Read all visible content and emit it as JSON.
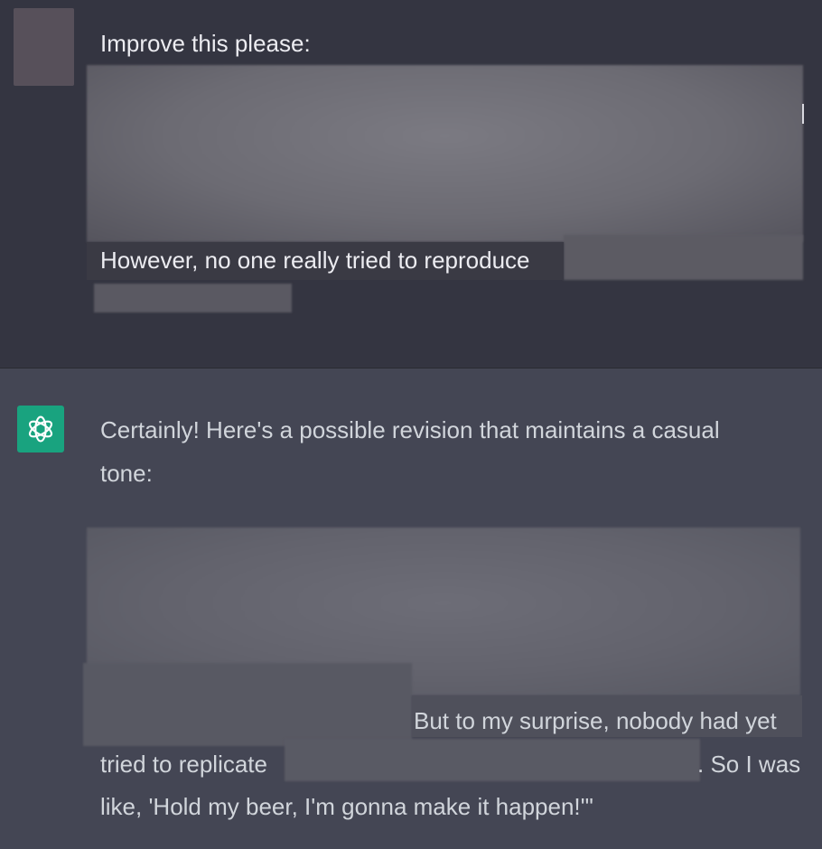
{
  "user_message": {
    "line1": "Improve this please:",
    "line2": "However, no one really tried to reproduce"
  },
  "assistant_message": {
    "line1": "Certainly! Here's a possible revision that maintains a casual",
    "line2": "tone:",
    "line3": "But to my surprise, nobody had yet",
    "line4a": "tried to replicate",
    "line4b": ". So I was",
    "line5": "like, 'Hold my beer, I'm gonna make it happen!'\""
  },
  "icons": {
    "assistant_avatar": "openai-logo-icon"
  },
  "colors": {
    "user_bg": "#343541",
    "assistant_bg": "#444654",
    "avatar_bg": "#19a37f"
  }
}
